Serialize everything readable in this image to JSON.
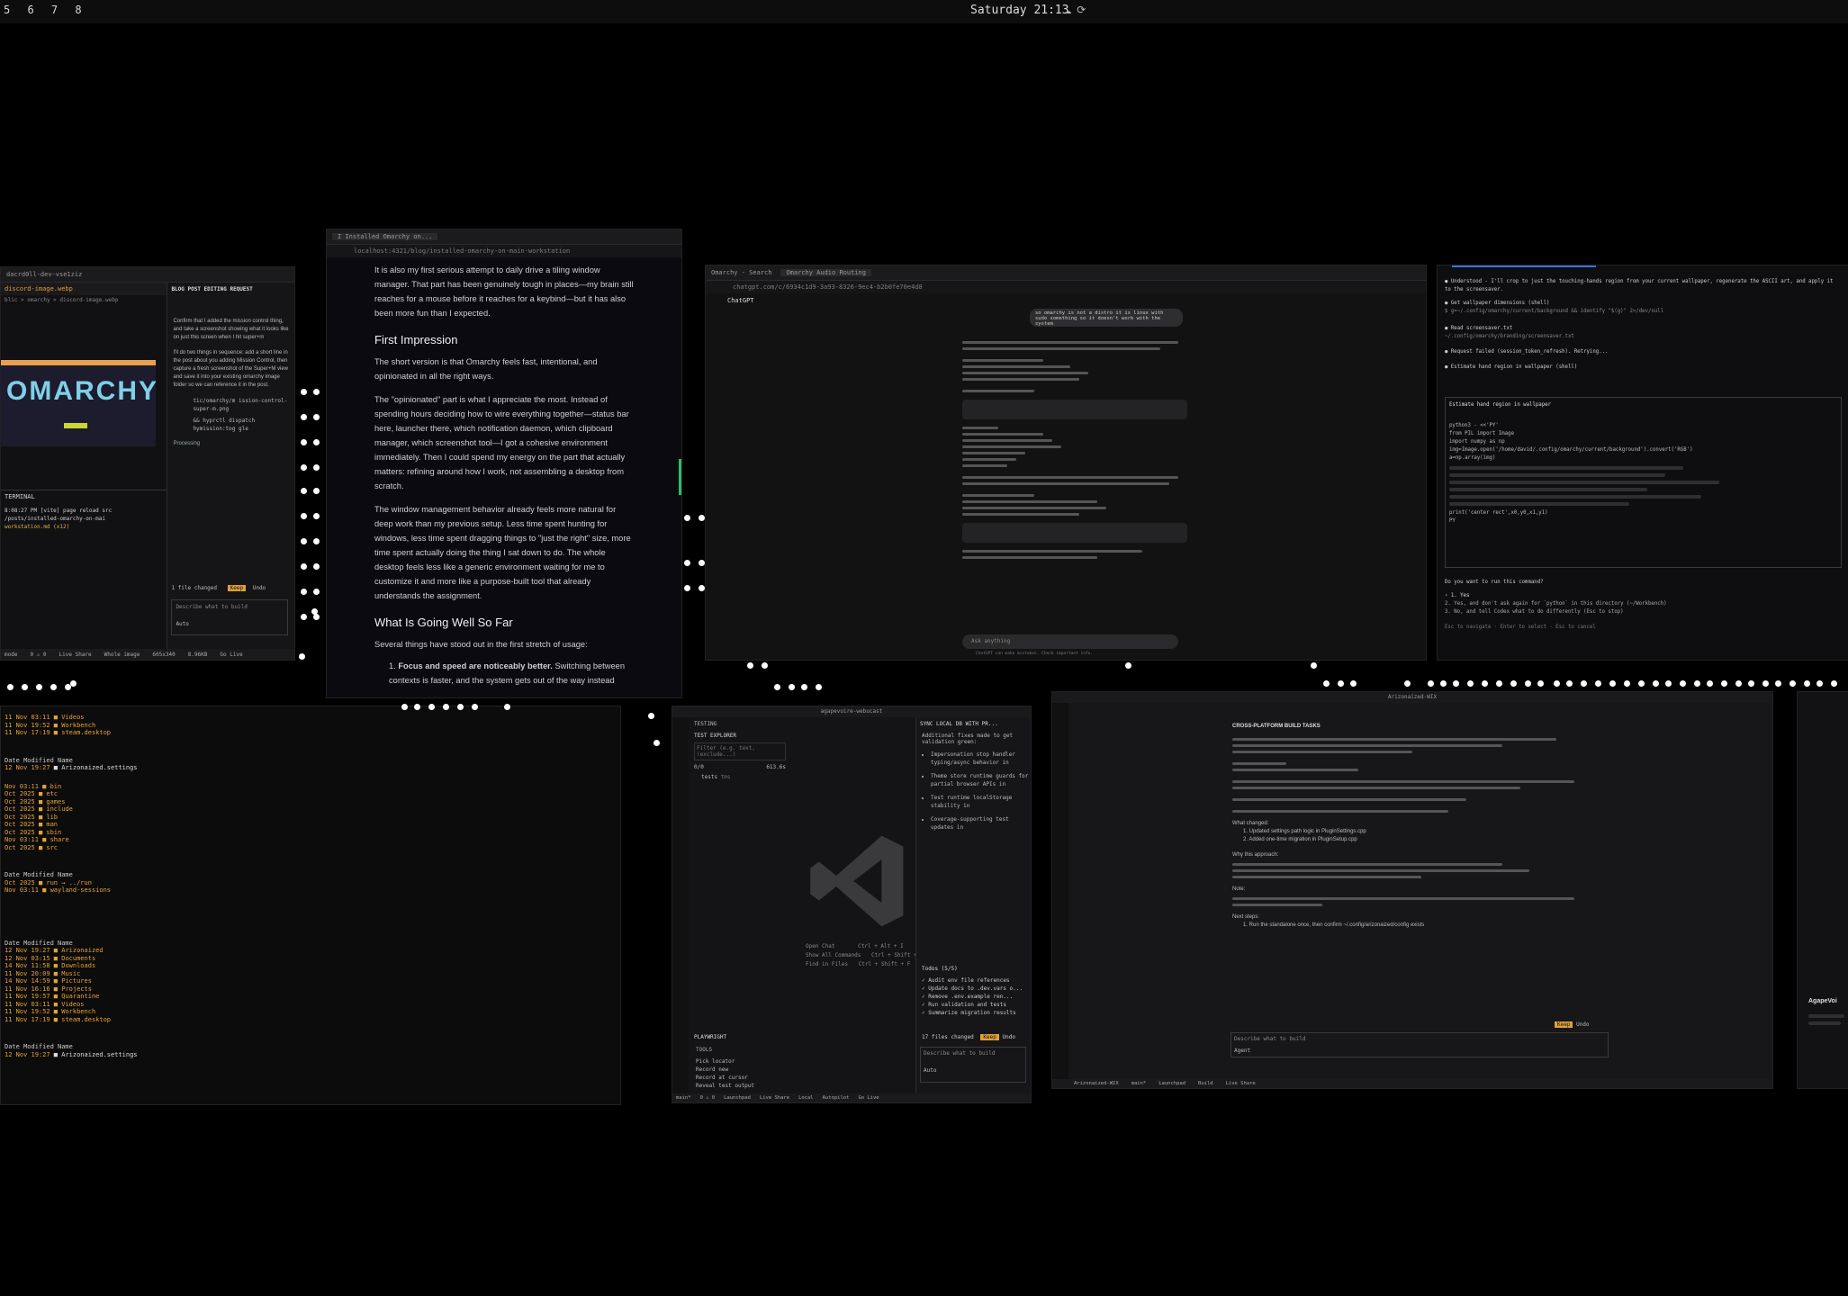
{
  "topbar": {
    "workspaces": "5 6 7 8",
    "clock": "Saturday 21:13",
    "status_icons": [
      "cloud-icon",
      "refresh-icon"
    ]
  },
  "win_vscode_left": {
    "tab_path": "dacrd0ll-dev-vse1ziz",
    "file_tab": "discord-image.webp",
    "breadcrumb": "blic > omarchy > discord-image.webp",
    "logo_text": "OMARCHY",
    "chat_header": "BLOG POST EDITING REQUEST",
    "chat_lines": [
      "Confirm that I added the mission control thing, and take a screenshot showing what it looks like on just this screen when I hit super+m",
      "I'll do two things in sequence: add a short line in the post about you adding Mission Control, then capture a fresh screenshot of the Super+M view and save it into your existing omarchy image folder so we can reference it in the post.",
      "tic/omarchy/m ission-control-super-m.png",
      "&& hyprctl dispatch hymission:tog gle",
      "Processing"
    ],
    "files_changed": "1 file changed",
    "keep": "Keep",
    "undo": "Undo",
    "input_placeholder": "Describe what to build",
    "mode": "Auto",
    "terminal_label": "TERMINAL",
    "terminal_lines": [
      "8:08:27 PM [vite] page reload src",
      "/posts/installed-omarchy-on-mai",
      "workstation.md (x12)"
    ],
    "status": [
      "mode",
      "0 ⚠ 0",
      "Live Share",
      "Whole image",
      "605x340",
      "8.96KB",
      "Go Live"
    ]
  },
  "win_browser_blog": {
    "tab": "I Installed Omarchy on...",
    "url": "localhost:4321/blog/installed-omarchy-on-main-workstation",
    "paragraphs": [
      "It is also my first serious attempt to daily drive a tiling window manager. That part has been genuinely tough in places—my brain still reaches for a mouse before it reaches for a keybind—but it has also been more fun than I expected.",
      "The short version is that Omarchy feels fast, intentional, and opinionated in all the right ways.",
      "The \"opinionated\" part is what I appreciate the most. Instead of spending hours deciding how to wire everything together—status bar here, launcher there, which notification daemon, which clipboard manager, which screenshot tool—I got a cohesive environment immediately. Then I could spend my energy on the part that actually matters: refining around how I work, not assembling a desktop from scratch.",
      "The window management behavior already feels more natural for deep work than my previous setup. Less time spent hunting for windows, less time spent dragging things to \"just the right\" size, more time spent actually doing the thing I sat down to do. The whole desktop feels less like a generic environment waiting for me to customize it and more like a purpose-built tool that already understands the assignment.",
      "Several things have stood out in the first stretch of usage:"
    ],
    "heading_1": "First Impression",
    "heading_2": "What Is Going Well So Far",
    "list_item_bold": "Focus and speed are noticeably better.",
    "list_item_rest": "Switching between contexts is faster, and the system gets out of the way instead"
  },
  "win_chatgpt": {
    "tabs": [
      "Omarchy - Search",
      "Omarchy Audio Routing"
    ],
    "url": "chatgpt.com/c/6934c1d9-3a93-8326-9ec4-b2b0fe70e4d8",
    "model": "ChatGPT",
    "user_bubble": "so omarchy is not a distro it is linux with sudo something so it doesn't work with the system",
    "input_placeholder": "Ask anything",
    "footer": "ChatGPT can make mistakes. Check important info."
  },
  "win_terminal_claude": {
    "lines": [
      "● Understood - I'll crop to just the touching-hands region from your current wallpaper, regenerate the ASCII art, and apply it to the screensaver.",
      "● Get wallpaper dimensions (shell)",
      "  $ g=~/.config/omarchy/current/background && identify \"$(g)\" 2>/dev/null",
      "● Read screensaver.txt",
      "  ~/.config/omarchy/branding/screensaver.txt",
      "● Request failed (session_token_refresh). Retrying...",
      "● Estimate hand region in wallpaper (shell)",
      "Estimate hand region in wallpaper",
      "python3 - <<'PY'",
      "from PIL import Image",
      "import numpy as np",
      "img=Image.open('/home/david/.config/omarchy/current/background').convert('RGB')",
      "a=np.array(img)",
      "print('center rect',x0,y0,x1,y1)",
      "PY",
      "Do you want to run this command?",
      "› 1. Yes",
      "  2. Yes, and don't ask again for `python` in this directory (~/Workbench)",
      "  3. No, and tell Codex what to do differently (Esc to stop)",
      "Esc to navigate · Enter to select · Esc to cancel"
    ]
  },
  "win_terminal_ls": {
    "block1": [
      [
        "11 Nov 03:11",
        "Videos"
      ],
      [
        "11 Nov 19:52",
        "Workbench"
      ],
      [
        "11 Nov 17:19",
        "steam.desktop"
      ]
    ],
    "header": "Date Modified Name",
    "block2": [
      [
        "12 Nov 19:27",
        "Arizonaized.settings"
      ]
    ],
    "block3": [
      [
        "Nov 03:11",
        "bin"
      ],
      [
        "Oct 2025",
        "etc"
      ],
      [
        "Oct 2025",
        "games"
      ],
      [
        "Oct 2025",
        "include"
      ],
      [
        "Oct 2025",
        "lib"
      ],
      [
        "Oct 2025",
        "man"
      ],
      [
        "Oct 2025",
        "sbin"
      ],
      [
        "Nov 03:11",
        "share"
      ],
      [
        "Oct 2025",
        "src"
      ]
    ],
    "block4": [
      [
        "Oct 2025",
        "run → ../run"
      ],
      [
        "Nov 03:11",
        "wayland-sessions"
      ]
    ],
    "block5": [
      [
        "12 Nov 19:27",
        "Arizonaized"
      ],
      [
        "12 Nov 03:15",
        "Documents"
      ],
      [
        "14 Nov 11:58",
        "Downloads"
      ],
      [
        "11 Nov 20:09",
        "Music"
      ],
      [
        "14 Nov 14:59",
        "Pictures"
      ],
      [
        "11 Nov 16:16",
        "Projects"
      ],
      [
        "11 Nov 19:57",
        "Quarantine"
      ],
      [
        "11 Nov 03:11",
        "Videos"
      ],
      [
        "11 Nov 19:52",
        "Workbench"
      ],
      [
        "11 Nov 17:19",
        "steam.desktop"
      ]
    ],
    "block6": [
      [
        "12 Nov 19:27",
        "Arizonaized.settings"
      ]
    ]
  },
  "win_vscode_testing": {
    "title": "agapevoire-webucast",
    "section": "TESTING",
    "explorer": "TEST EXPLORER",
    "filter": "Filter (e.g. text, !exclude...)",
    "run_status": "0/0",
    "duration": "613.6s",
    "tests_label": "tests",
    "tests_sub": "tms",
    "playwright": "PLAYWRIGHT",
    "tools": "TOOLS",
    "tool_items": [
      "Pick locator",
      "Record new",
      "Record at cursor",
      "Reveal test output"
    ],
    "shortcuts": [
      [
        "Open Chat",
        "Ctrl + Alt + I"
      ],
      [
        "Show All Commands",
        "Ctrl + Shift + P"
      ],
      [
        "Find in Files",
        "Ctrl + Shift + F"
      ]
    ],
    "chat_title": "SYNC LOCAL DB WITH PR...",
    "chat_intro": "Additional fixes made to get validation green:",
    "chat_bullets": [
      "Impersonation stop handler typing/async behavior in",
      "Theme store runtime guards for partial browser APIs in",
      "Test runtime localStorage stability in",
      "Coverage-supporting test updates in"
    ],
    "todos_label": "Todos (5/5)",
    "todos": [
      "Audit env file references",
      "Update docs to .dev.vars o...",
      "Remove .env.example ren...",
      "Run validation and tests",
      "Summarize migration results"
    ],
    "files_changed": "17 files changed",
    "keep": "Keep",
    "undo": "Undo",
    "input_placeholder": "Describe what to build",
    "mode": "Auto",
    "status": [
      "main*",
      "0 ⚠ 0",
      "Launchpad",
      "Live Share",
      "Local",
      "Autopilot",
      "Go Live"
    ]
  },
  "win_vscode_wide": {
    "title": "Arizonaized-WIX",
    "heading": "CROSS-PLATFORM BUILD TASKS",
    "paragraph_heads": [
      "What changed:",
      "Why this approach:",
      "Note:",
      "Next steps:"
    ],
    "list_items": [
      "Updated settings path logic in PluginSettings.cpp",
      "Added one-time migration in PluginSetup.cpp",
      "Run the standalone once, then confirm ~/.config/arizonaized/config exists"
    ],
    "input_placeholder": "Describe what to build",
    "mode": "Agent",
    "keep": "Keep",
    "undo": "Undo",
    "status": [
      "Arizonaized-WIX",
      "main*",
      "Launchpad",
      "Build",
      "Live Share"
    ]
  },
  "win_partial_right": {
    "label": "AgapeVoi"
  }
}
